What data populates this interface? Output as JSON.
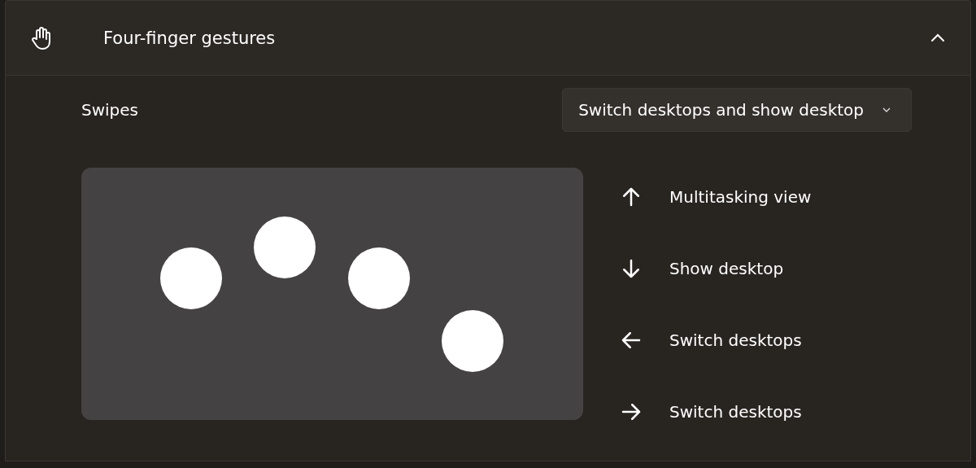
{
  "section": {
    "title": "Four-finger gestures",
    "expanded": true
  },
  "swipes": {
    "label": "Swipes",
    "value": "Switch desktops and show desktop"
  },
  "gestures": [
    {
      "kind": "up",
      "label": "Multitasking view"
    },
    {
      "kind": "down",
      "label": "Show desktop"
    },
    {
      "kind": "left",
      "label": "Switch desktops"
    },
    {
      "kind": "right",
      "label": "Switch desktops"
    }
  ]
}
